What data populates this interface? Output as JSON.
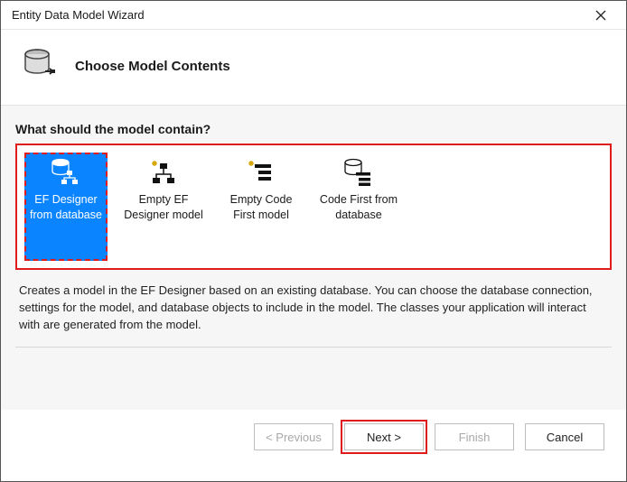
{
  "window": {
    "title": "Entity Data Model Wizard"
  },
  "header": {
    "title": "Choose Model Contents"
  },
  "question": "What should the model contain?",
  "options": [
    {
      "label": "EF Designer from database",
      "selected": true
    },
    {
      "label": "Empty EF Designer model",
      "selected": false
    },
    {
      "label": "Empty Code First model",
      "selected": false
    },
    {
      "label": "Code First from database",
      "selected": false
    }
  ],
  "description": "Creates a model in the EF Designer based on an existing database. You can choose the database connection, settings for the model, and database objects to include in the model. The classes your application will interact with are generated from the model.",
  "buttons": {
    "previous": "< Previous",
    "next": "Next >",
    "finish": "Finish",
    "cancel": "Cancel"
  }
}
